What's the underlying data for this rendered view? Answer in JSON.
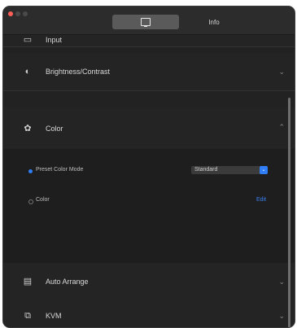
{
  "window": {
    "tabs": [
      {
        "label": "",
        "icon": "monitor-icon",
        "active": true
      },
      {
        "label": "Info",
        "active": false
      }
    ]
  },
  "rows": [
    {
      "id": "cutoff",
      "label": "Input",
      "icon": "input-icon"
    },
    {
      "id": "brightness",
      "label": "Brightness/Contrast",
      "icon": "brightness-icon"
    },
    {
      "id": "color",
      "label": "Color",
      "icon": "palette-icon",
      "expanded": true
    },
    {
      "id": "audio",
      "label": "Auto Arrange",
      "icon": "arrange-icon"
    },
    {
      "id": "kvm",
      "label": "KVM",
      "icon": "kvm-icon"
    }
  ],
  "color_panel": {
    "option1_label": "Preset Color Mode",
    "option1_selected": true,
    "select_value": "Standard",
    "option2_label": "Color",
    "option2_selected": false,
    "link_label": "Edit"
  }
}
